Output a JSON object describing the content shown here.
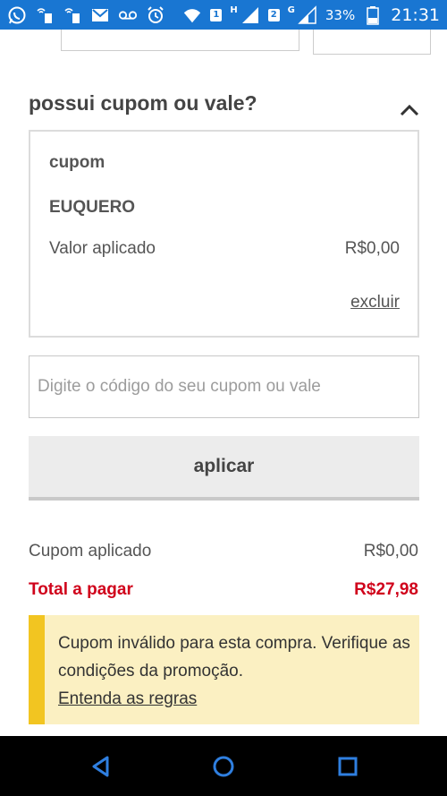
{
  "status_bar": {
    "battery_percent": "33%",
    "time": "21:31",
    "sim1": "1",
    "sim2": "2",
    "sim1_network": "H",
    "sim2_network": "G",
    "icons": [
      "whatsapp-icon",
      "wifi-calling-icon",
      "wifi-calling-icon",
      "email-icon",
      "voicemail-icon",
      "alarm-icon",
      "wifi-icon",
      "sim1-signal-icon",
      "sim2-signal-icon",
      "battery-icon"
    ],
    "color": "#1976d2"
  },
  "coupon_section": {
    "title": "possui cupom ou vale?",
    "toggle_icon": "chevron-up-icon",
    "applied_coupon": {
      "label": "cupom",
      "code": "EUQUERO",
      "applied_value_label": "Valor aplicado",
      "applied_value": "R$0,00",
      "remove_label": "excluir"
    },
    "input": {
      "value": "",
      "placeholder": "Digite o código do seu cupom ou vale"
    },
    "apply_button_label": "aplicar"
  },
  "summary": {
    "coupon_applied_label": "Cupom aplicado",
    "coupon_applied_value": "R$0,00",
    "total_label": "Total a pagar",
    "total_value": "R$27,98",
    "total_color": "#d0021b"
  },
  "alert": {
    "message": "Cupom inválido para esta compra. Verifique as condições da promoção.",
    "link_label": "Entenda as regras",
    "bar_color": "#f2c521",
    "background": "#fbf0c2"
  },
  "nav_bar": {
    "icons": [
      "back-icon",
      "home-icon",
      "recents-icon"
    ]
  }
}
